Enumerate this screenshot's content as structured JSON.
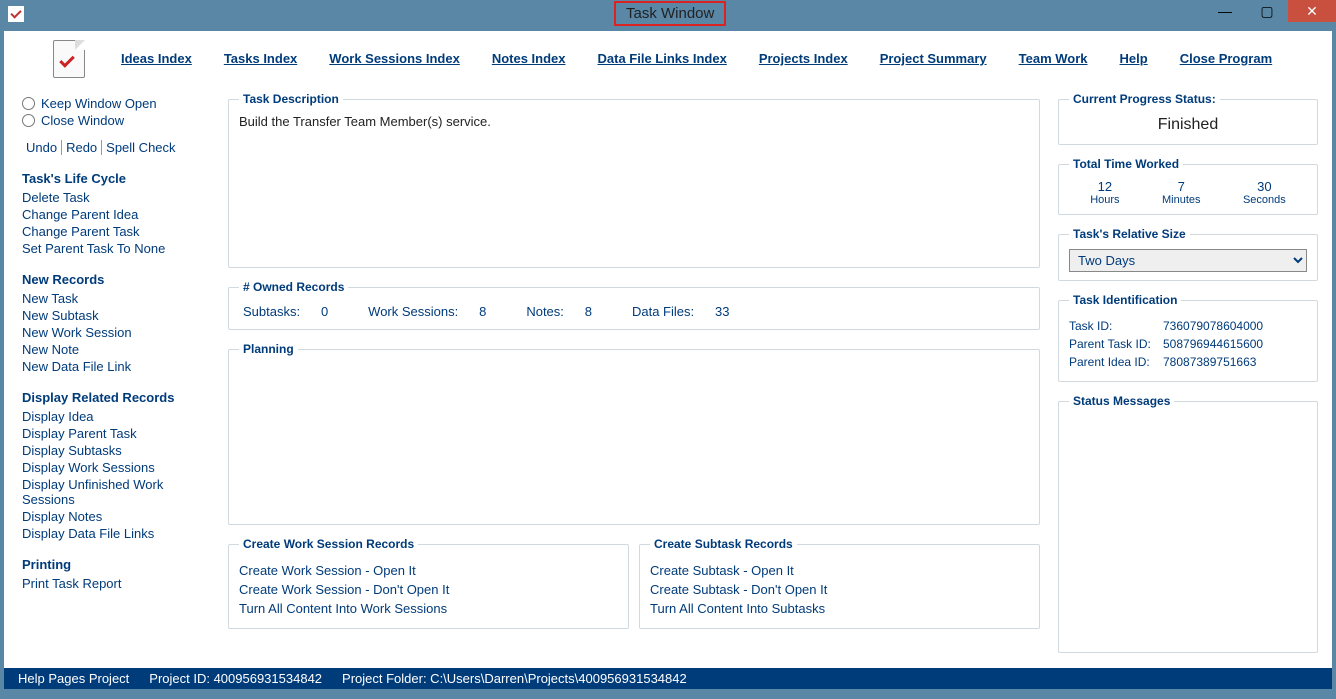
{
  "window": {
    "title": "Task Window"
  },
  "menu": {
    "ideas": "Ideas Index",
    "tasks": "Tasks Index",
    "work": "Work Sessions Index",
    "notes": "Notes Index",
    "data": "Data File Links Index",
    "projects": "Projects Index",
    "summary": "Project Summary",
    "team": "Team Work",
    "help": "Help",
    "close": "Close Program"
  },
  "sidebar": {
    "keep_open": "Keep Window Open",
    "close_window": "Close Window",
    "undo": "Undo",
    "redo": "Redo",
    "spell": "Spell Check",
    "life_title": "Task's Life Cycle",
    "delete": "Delete Task",
    "chg_idea": "Change Parent Idea",
    "chg_task": "Change Parent Task",
    "set_none": "Set Parent Task To None",
    "new_title": "New Records",
    "new_task": "New Task",
    "new_sub": "New Subtask",
    "new_ws": "New Work Session",
    "new_note": "New Note",
    "new_dfl": "New Data File Link",
    "disp_title": "Display Related Records",
    "disp_idea": "Display Idea",
    "disp_parent": "Display Parent Task",
    "disp_sub": "Display Subtasks",
    "disp_ws": "Display Work Sessions",
    "disp_uws": "Display Unfinished Work Sessions",
    "disp_notes": "Display Notes",
    "disp_dfl": "Display Data File Links",
    "print_title": "Printing",
    "print_report": "Print Task Report"
  },
  "center": {
    "desc_legend": "Task Description",
    "desc_text": "Build the Transfer Team Member(s) service.",
    "owned_legend": "# Owned Records",
    "subtasks_lbl": "Subtasks:",
    "subtasks_val": "0",
    "ws_lbl": "Work Sessions:",
    "ws_val": "8",
    "notes_lbl": "Notes:",
    "notes_val": "8",
    "df_lbl": "Data Files:",
    "df_val": "33",
    "planning_legend": "Planning",
    "cws_legend": "Create Work Session Records",
    "cws_open": "Create Work Session - Open It",
    "cws_dont": "Create Work Session - Don't Open It",
    "cws_turn": "Turn All Content Into Work Sessions",
    "csr_legend": "Create Subtask Records",
    "csr_open": "Create Subtask - Open It",
    "csr_dont": "Create Subtask - Don't Open It",
    "csr_turn": "Turn All Content Into Subtasks"
  },
  "right": {
    "progress_legend": "Current Progress Status:",
    "progress_val": "Finished",
    "time_legend": "Total Time Worked",
    "hours_v": "12",
    "hours_l": "Hours",
    "min_v": "7",
    "min_l": "Minutes",
    "sec_v": "30",
    "sec_l": "Seconds",
    "size_legend": "Task's Relative Size",
    "size_val": "Two Days",
    "ident_legend": "Task Identification",
    "task_id_l": "Task ID:",
    "task_id_v": "736079078604000",
    "ptask_id_l": "Parent Task ID:",
    "ptask_id_v": "508796944615600",
    "pidea_id_l": "Parent Idea ID:",
    "pidea_id_v": "78087389751663",
    "status_legend": "Status Messages"
  },
  "statusbar": {
    "help": "Help Pages Project",
    "pid": "Project ID: 400956931534842",
    "folder": "Project Folder: C:\\Users\\Darren\\Projects\\400956931534842"
  }
}
